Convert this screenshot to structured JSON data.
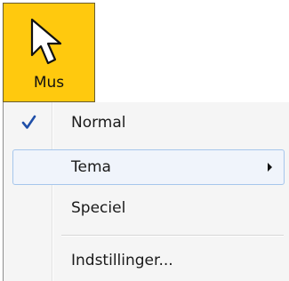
{
  "button": {
    "label": "Mus",
    "icon": "mouse-pointer-icon",
    "background": "#ffc90e"
  },
  "menu": {
    "items": [
      {
        "label": "Normal",
        "checked": true
      },
      {
        "label": "Tema",
        "submenu": true,
        "highlighted": true
      },
      {
        "label": "Speciel"
      },
      {
        "label": "Indstillinger..."
      }
    ],
    "check_icon": "checkmark-icon",
    "submenu_icon": "submenu-arrow-icon",
    "check_color": "#1f4fa8",
    "highlight_color": "#a6c6ec"
  }
}
